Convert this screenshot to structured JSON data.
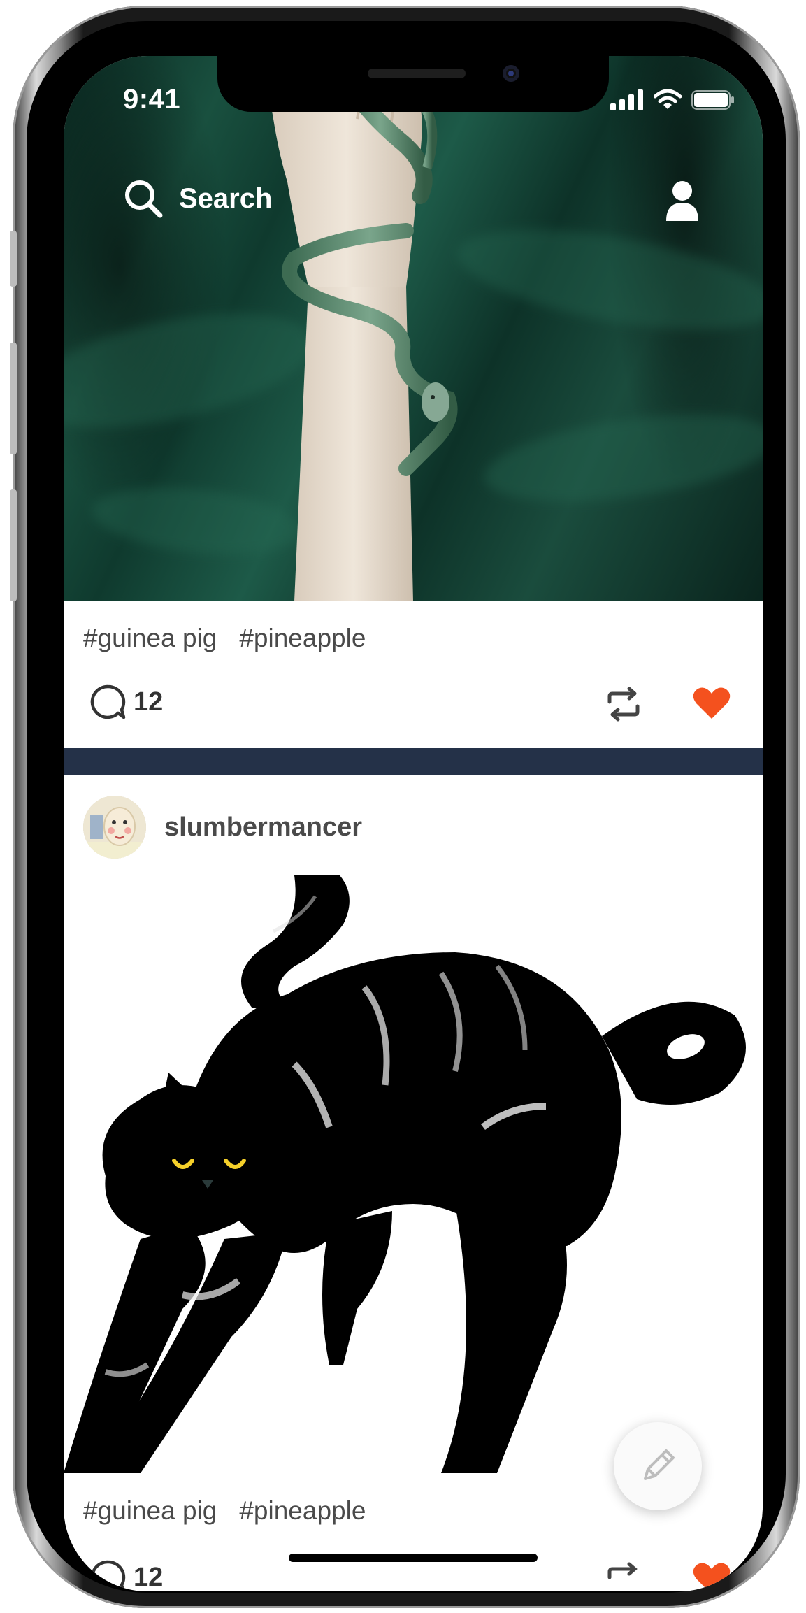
{
  "status_bar": {
    "time": "9:41"
  },
  "header": {
    "search_label": "Search"
  },
  "posts": [
    {
      "tags": [
        "#guinea pig",
        "#pineapple"
      ],
      "comment_count": "12",
      "liked": true
    },
    {
      "username": "slumbermancer",
      "tags": [
        "#guinea pig",
        "#pineapple"
      ],
      "comment_count": "12",
      "liked": true
    }
  ],
  "colors": {
    "like_red": "#f4511e",
    "divider_navy": "#243148",
    "tag_text": "#4a4a4a"
  },
  "icons": {
    "search": "search-icon",
    "profile": "person-icon",
    "comment": "comment-bubble-icon",
    "reblog": "reblog-icon",
    "like": "heart-icon",
    "compose": "pencil-icon"
  }
}
